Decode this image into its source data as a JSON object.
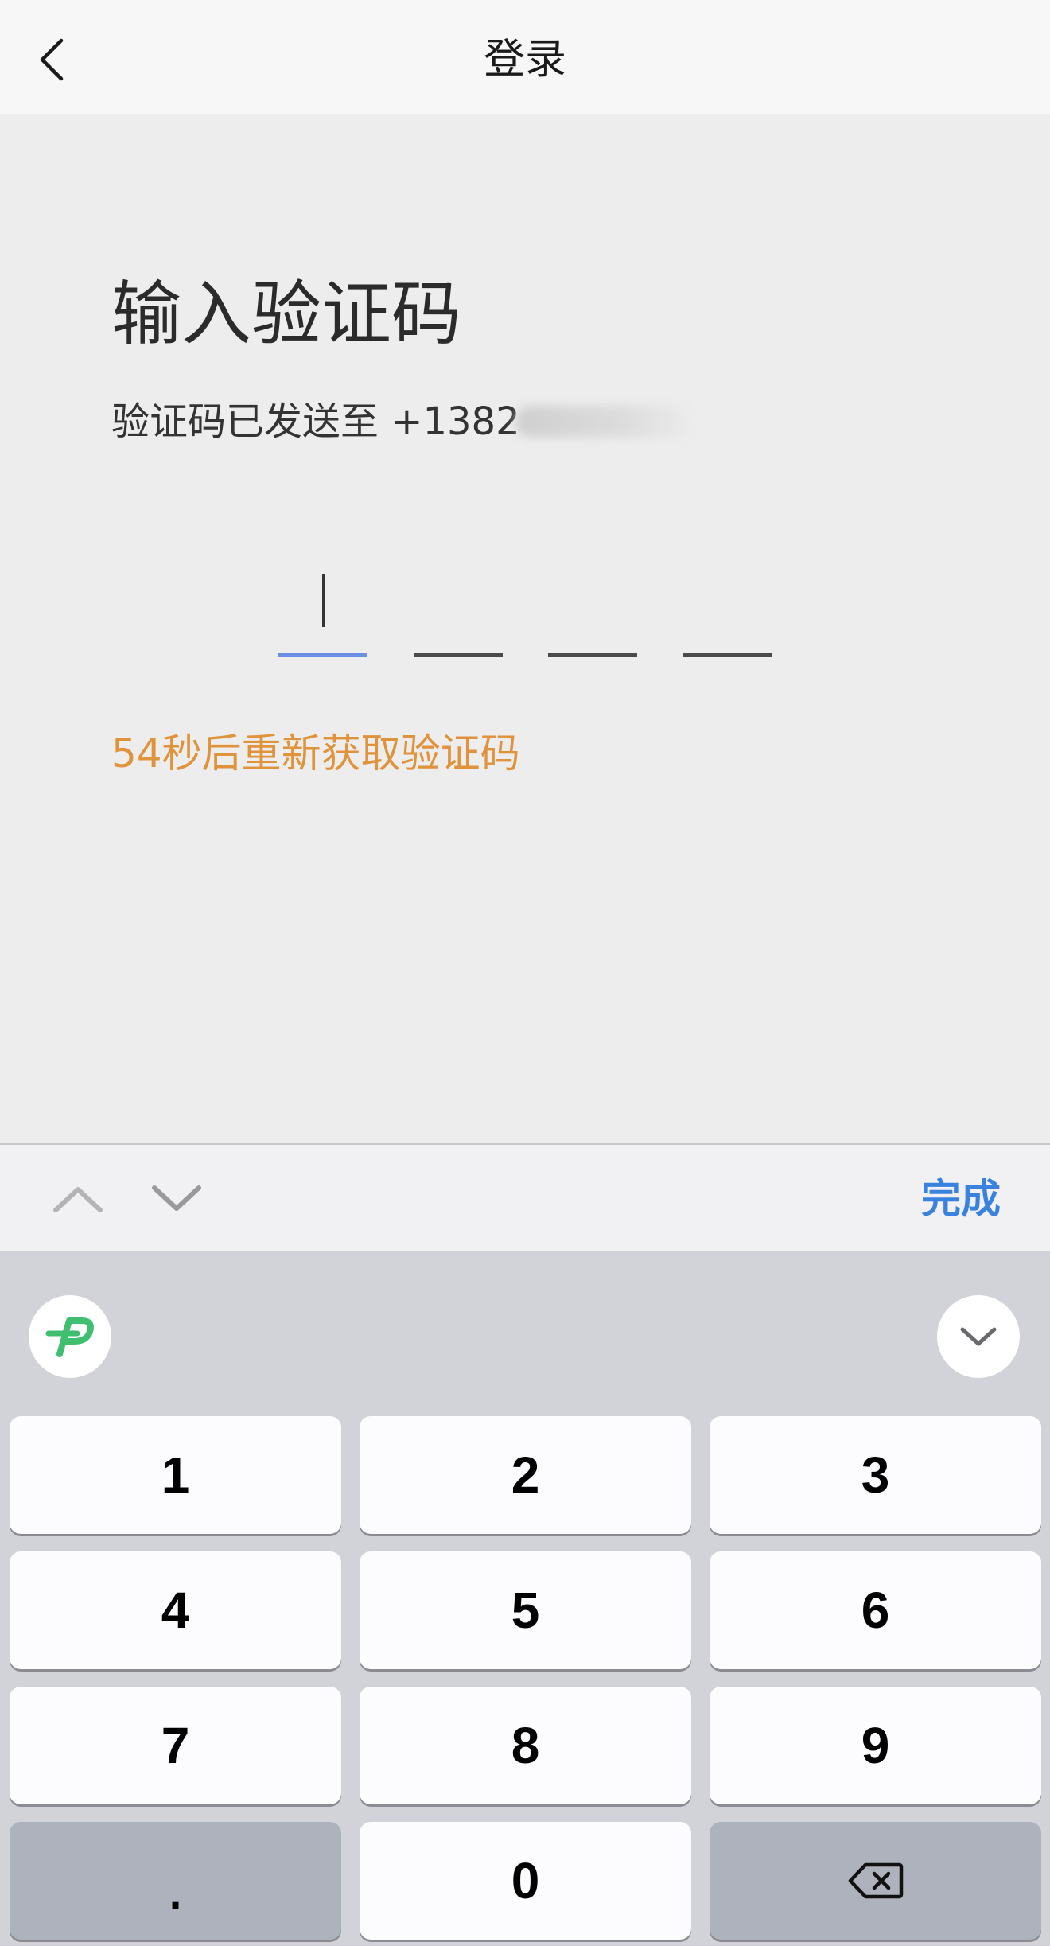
{
  "navbar": {
    "title": "登录"
  },
  "main": {
    "heading": "输入验证码",
    "sent_prefix": "验证码已发送至 +1382",
    "resend_countdown": "54秒后重新获取验证码"
  },
  "colors": {
    "accent": "#6b8fe5",
    "countdown": "#e0933a",
    "done": "#3a82e0"
  },
  "accessory": {
    "done_label": "完成"
  },
  "keyboard": {
    "keys": [
      "1",
      "2",
      "3",
      "4",
      "5",
      "6",
      "7",
      "8",
      "9",
      ".",
      "0"
    ],
    "icons": {
      "logo": "keyboard-app-logo-icon",
      "hide": "chevron-down-icon",
      "delete": "backspace-icon"
    }
  }
}
